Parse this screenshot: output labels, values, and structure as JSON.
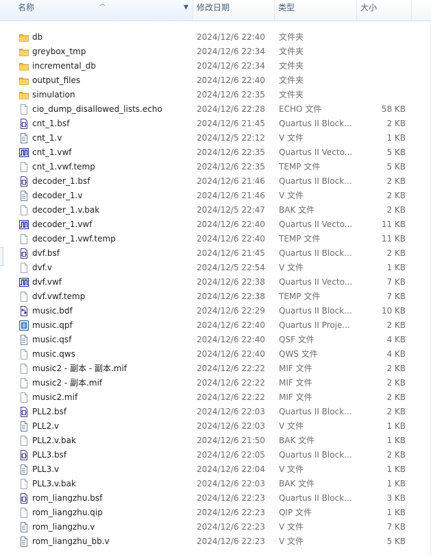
{
  "header": {
    "name": "名称",
    "date": "修改日期",
    "type": "类型",
    "size": "大小"
  },
  "files": [
    {
      "name": "db",
      "date": "2024/12/6 22:40",
      "type": "文件夹",
      "size": "",
      "icon": "folder"
    },
    {
      "name": "greybox_tmp",
      "date": "2024/12/6 22:34",
      "type": "文件夹",
      "size": "",
      "icon": "folder"
    },
    {
      "name": "incremental_db",
      "date": "2024/12/6 22:34",
      "type": "文件夹",
      "size": "",
      "icon": "folder"
    },
    {
      "name": "output_files",
      "date": "2024/12/6 22:40",
      "type": "文件夹",
      "size": "",
      "icon": "folder"
    },
    {
      "name": "simulation",
      "date": "2024/12/6 22:35",
      "type": "文件夹",
      "size": "",
      "icon": "folder"
    },
    {
      "name": "cio_dump_disallowed_lists.echo",
      "date": "2024/12/6 22:28",
      "type": "ECHO 文件",
      "size": "58 KB",
      "icon": "file"
    },
    {
      "name": "cnt_1.bsf",
      "date": "2024/12/6 21:45",
      "type": "Quartus II Block...",
      "size": "2 KB",
      "icon": "bsf"
    },
    {
      "name": "cnt_1.v",
      "date": "2024/12/5 22:12",
      "type": "V 文件",
      "size": "1 KB",
      "icon": "v"
    },
    {
      "name": "cnt_1.vwf",
      "date": "2024/12/6 22:35",
      "type": "Quartus II Vecto...",
      "size": "5 KB",
      "icon": "vwf"
    },
    {
      "name": "cnt_1.vwf.temp",
      "date": "2024/12/6 22:35",
      "type": "TEMP 文件",
      "size": "5 KB",
      "icon": "file"
    },
    {
      "name": "decoder_1.bsf",
      "date": "2024/12/6 21:46",
      "type": "Quartus II Block...",
      "size": "2 KB",
      "icon": "bsf"
    },
    {
      "name": "decoder_1.v",
      "date": "2024/12/6 21:46",
      "type": "V 文件",
      "size": "2 KB",
      "icon": "v"
    },
    {
      "name": "decoder_1.v.bak",
      "date": "2024/12/5 22:47",
      "type": "BAK 文件",
      "size": "2 KB",
      "icon": "file"
    },
    {
      "name": "decoder_1.vwf",
      "date": "2024/12/6 22:40",
      "type": "Quartus II Vecto...",
      "size": "11 KB",
      "icon": "vwf"
    },
    {
      "name": "decoder_1.vwf.temp",
      "date": "2024/12/6 22:40",
      "type": "TEMP 文件",
      "size": "11 KB",
      "icon": "file"
    },
    {
      "name": "dvf.bsf",
      "date": "2024/12/6 21:45",
      "type": "Quartus II Block...",
      "size": "2 KB",
      "icon": "bsf"
    },
    {
      "name": "dvf.v",
      "date": "2024/12/5 22:54",
      "type": "V 文件",
      "size": "1 KB",
      "icon": "file"
    },
    {
      "name": "dvf.vwf",
      "date": "2024/12/6 22:38",
      "type": "Quartus II Vecto...",
      "size": "7 KB",
      "icon": "vwf"
    },
    {
      "name": "dvf.vwf.temp",
      "date": "2024/12/6 22:38",
      "type": "TEMP 文件",
      "size": "7 KB",
      "icon": "file"
    },
    {
      "name": "music.bdf",
      "date": "2024/12/6 22:29",
      "type": "Quartus II Block...",
      "size": "10 KB",
      "icon": "bdf"
    },
    {
      "name": "music.qpf",
      "date": "2024/12/6 22:40",
      "type": "Quartus II Proje...",
      "size": "2 KB",
      "icon": "qpf"
    },
    {
      "name": "music.qsf",
      "date": "2024/12/6 22:40",
      "type": "QSF 文件",
      "size": "4 KB",
      "icon": "v"
    },
    {
      "name": "music.qws",
      "date": "2024/12/6 22:40",
      "type": "QWS 文件",
      "size": "4 KB",
      "icon": "file"
    },
    {
      "name": "music2 - 副本 - 副本.mif",
      "date": "2024/12/6 22:22",
      "type": "MIF 文件",
      "size": "2 KB",
      "icon": "file"
    },
    {
      "name": "music2 - 副本.mif",
      "date": "2024/12/6 22:22",
      "type": "MIF 文件",
      "size": "2 KB",
      "icon": "file"
    },
    {
      "name": "music2.mif",
      "date": "2024/12/6 22:22",
      "type": "MIF 文件",
      "size": "2 KB",
      "icon": "file"
    },
    {
      "name": "PLL2.bsf",
      "date": "2024/12/6 22:03",
      "type": "Quartus II Block...",
      "size": "2 KB",
      "icon": "bsf"
    },
    {
      "name": "PLL2.v",
      "date": "2024/12/6 22:03",
      "type": "V 文件",
      "size": "1 KB",
      "icon": "v"
    },
    {
      "name": "PLL2.v.bak",
      "date": "2024/12/6 21:50",
      "type": "BAK 文件",
      "size": "1 KB",
      "icon": "file"
    },
    {
      "name": "PLL3.bsf",
      "date": "2024/12/6 22:05",
      "type": "Quartus II Block...",
      "size": "2 KB",
      "icon": "bsf"
    },
    {
      "name": "PLL3.v",
      "date": "2024/12/6 22:04",
      "type": "V 文件",
      "size": "1 KB",
      "icon": "v"
    },
    {
      "name": "PLL3.v.bak",
      "date": "2024/12/6 22:03",
      "type": "BAK 文件",
      "size": "1 KB",
      "icon": "file"
    },
    {
      "name": "rom_liangzhu.bsf",
      "date": "2024/12/6 22:23",
      "type": "Quartus II Block...",
      "size": "3 KB",
      "icon": "bsf"
    },
    {
      "name": "rom_liangzhu.qip",
      "date": "2024/12/6 22:23",
      "type": "QIP 文件",
      "size": "1 KB",
      "icon": "file"
    },
    {
      "name": "rom_liangzhu.v",
      "date": "2024/12/6 22:23",
      "type": "V 文件",
      "size": "7 KB",
      "icon": "v"
    },
    {
      "name": "rom_liangzhu_bb.v",
      "date": "2024/12/6 22:23",
      "type": "V 文件",
      "size": "5 KB",
      "icon": "v"
    }
  ]
}
